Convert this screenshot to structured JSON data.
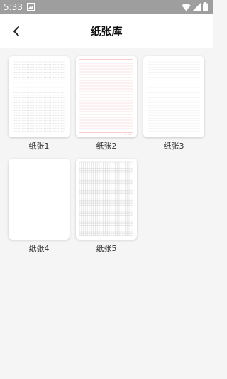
{
  "status_bar": {
    "time": "5:33",
    "icons": [
      "image-icon",
      "wifi-icon",
      "signal-icon",
      "battery-icon"
    ]
  },
  "header": {
    "title": "纸张库",
    "back_icon": "chevron-left-icon"
  },
  "papers": [
    {
      "label": "纸张1",
      "pattern": "gray-lines"
    },
    {
      "label": "纸张2",
      "pattern": "red-ruled-lines"
    },
    {
      "label": "纸张3",
      "pattern": "faint-lines"
    },
    {
      "label": "纸张4",
      "pattern": "blank"
    },
    {
      "label": "纸张5",
      "pattern": "grid"
    }
  ],
  "colors": {
    "status_bar": "#9e9e9e",
    "page_background": "#f5f5f5",
    "card_background": "#ffffff",
    "line_gray": "#cccccc",
    "line_red": "#f0a0a0"
  }
}
